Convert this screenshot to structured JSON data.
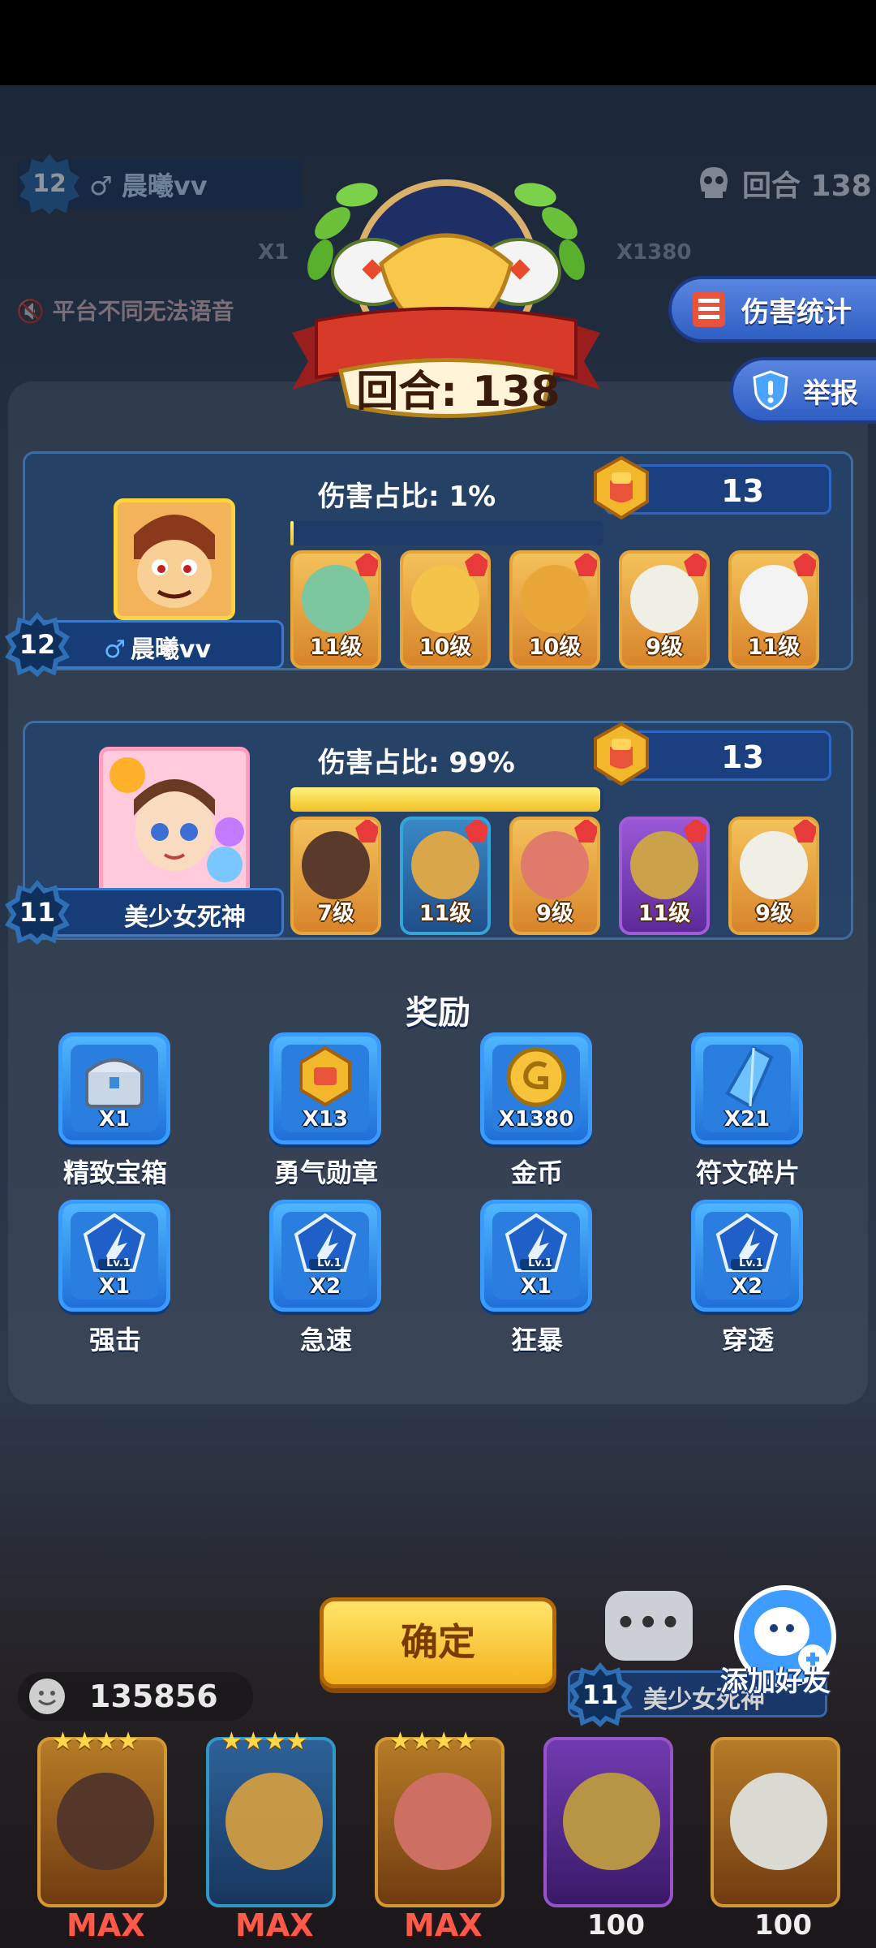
{
  "hud": {
    "player_level": "12",
    "player_name": "晨曦vv",
    "round_label": "回合 138",
    "voice_notice": "平台不同无法语音",
    "counter_1": "X1",
    "counter_2": "X1380"
  },
  "side_buttons": {
    "damage_stats": "伤害统计",
    "report": "举报"
  },
  "emblem": {
    "round_text": "回合: 138"
  },
  "players": [
    {
      "level": "12",
      "gender": "♂",
      "name": "晨曦vv",
      "damage_label": "伤害占比: 1%",
      "damage_share": 0.01,
      "medals": "13",
      "heroes": [
        {
          "level": "11级",
          "frame": "gold"
        },
        {
          "level": "10级",
          "frame": "gold"
        },
        {
          "level": "10级",
          "frame": "gold"
        },
        {
          "level": "9级",
          "frame": "gold"
        },
        {
          "level": "11级",
          "frame": "gold"
        }
      ]
    },
    {
      "level": "11",
      "gender": "",
      "name": "美少女死神",
      "damage_label": "伤害占比: 99%",
      "damage_share": 0.99,
      "medals": "13",
      "heroes": [
        {
          "level": "7级",
          "frame": "gold"
        },
        {
          "level": "11级",
          "frame": "blue"
        },
        {
          "level": "9级",
          "frame": "gold"
        },
        {
          "level": "11级",
          "frame": "purple"
        },
        {
          "level": "9级",
          "frame": "gold"
        }
      ]
    }
  ],
  "rewards": {
    "title": "奖励",
    "items": [
      {
        "name": "精致宝箱",
        "qty": "X1",
        "icon": "chest-icon"
      },
      {
        "name": "勇气勋章",
        "qty": "X13",
        "icon": "medal-icon"
      },
      {
        "name": "金币",
        "qty": "X1380",
        "icon": "coin-icon"
      },
      {
        "name": "符文碎片",
        "qty": "X21",
        "icon": "crystal-icon"
      },
      {
        "name": "强击",
        "qty": "X1",
        "icon": "rune-strike-icon",
        "tag": "Lv.1"
      },
      {
        "name": "急速",
        "qty": "X2",
        "icon": "rune-haste-icon",
        "tag": "Lv.1"
      },
      {
        "name": "狂暴",
        "qty": "X1",
        "icon": "rune-rage-icon",
        "tag": "Lv.1"
      },
      {
        "name": "穿透",
        "qty": "X2",
        "icon": "rune-pierce-icon",
        "tag": "Lv.1"
      }
    ]
  },
  "bottom": {
    "confirm": "确定",
    "chat": "•••",
    "add_friend": "添加好友",
    "coins": "135856",
    "teammate_level": "11",
    "teammate_name": "美少女死神",
    "stars": "★★★★",
    "max_label": "MAX",
    "hundred_label": "100"
  },
  "colors": {
    "accent_gold": "#f5b21e",
    "panel_blue": "#1c3f80",
    "damage_fill": "#f2c128"
  }
}
